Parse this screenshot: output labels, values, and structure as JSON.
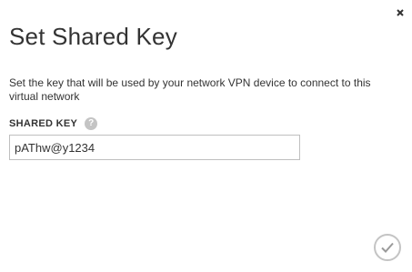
{
  "dialog": {
    "title": "Set Shared Key",
    "description": "Set the key that will be used by your network VPN device to connect to this virtual network",
    "close_icon": "close-icon",
    "confirm_icon": "checkmark-icon"
  },
  "shared_key": {
    "label": "SHARED KEY",
    "help_glyph": "?",
    "value": "pAThw@y1234"
  },
  "colors": {
    "text": "#333333",
    "icon_gray": "#c4c4c4",
    "border": "#bfbfbf"
  }
}
